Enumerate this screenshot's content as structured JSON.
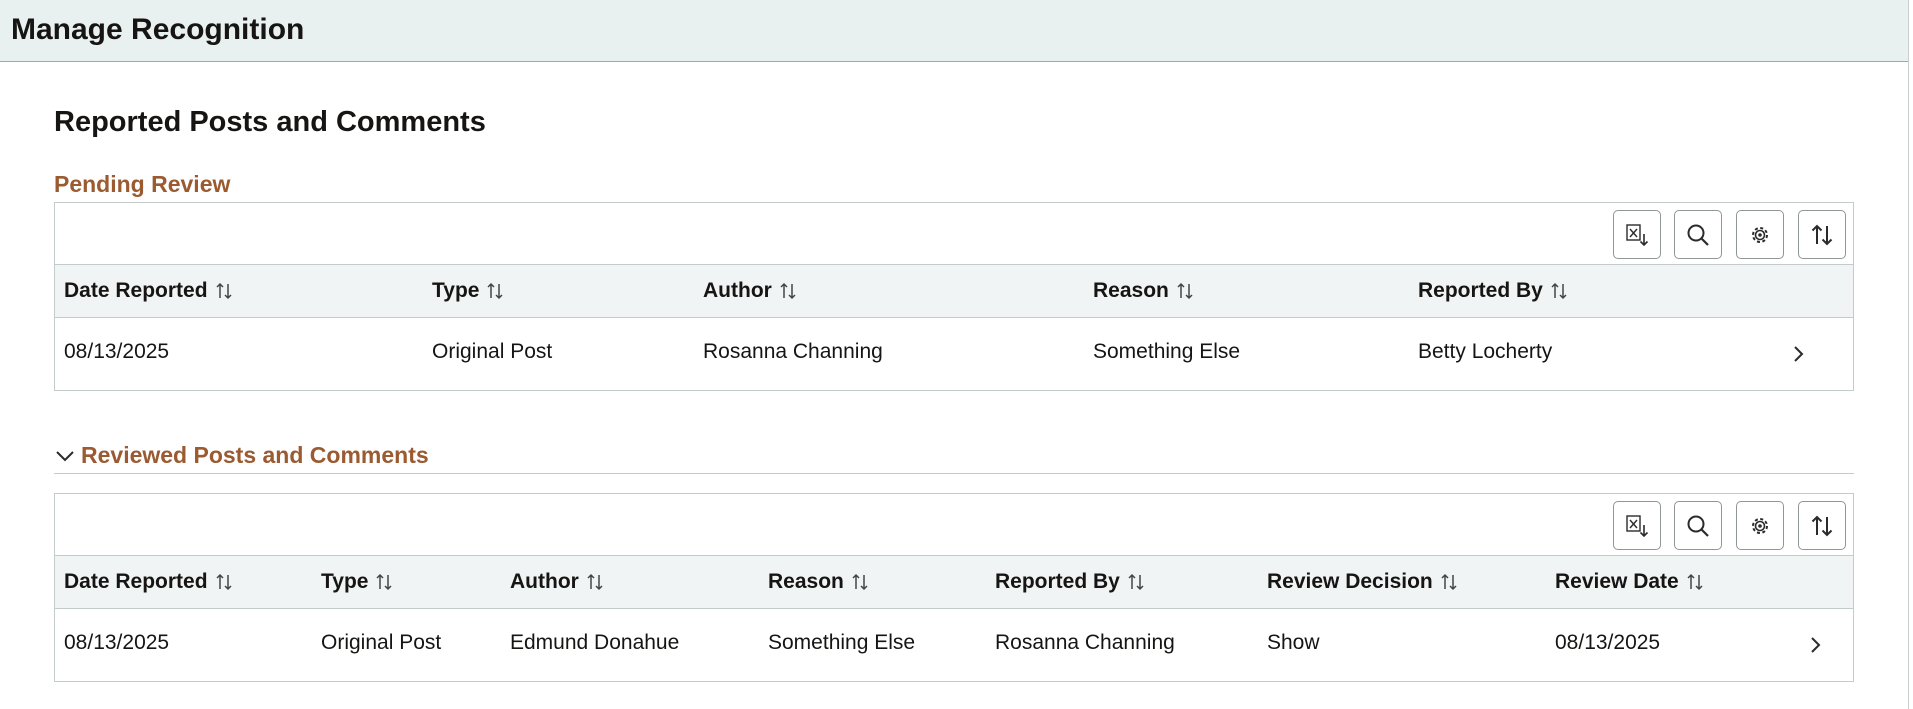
{
  "page": {
    "title": "Manage Recognition"
  },
  "section": {
    "title": "Reported Posts and Comments"
  },
  "pending": {
    "title": "Pending Review",
    "columns": [
      "Date Reported",
      "Type",
      "Author",
      "Reason",
      "Reported By"
    ],
    "rows": [
      [
        "08/13/2025",
        "Original Post",
        "Rosanna Channing",
        "Something Else",
        "Betty Locherty"
      ]
    ]
  },
  "reviewed": {
    "title": "Reviewed Posts and Comments",
    "columns": [
      "Date Reported",
      "Type",
      "Author",
      "Reason",
      "Reported By",
      "Review Decision",
      "Review Date"
    ],
    "rows": [
      [
        "08/13/2025",
        "Original Post",
        "Edmund Donahue",
        "Something Else",
        "Rosanna Channing",
        "Show",
        "08/13/2025"
      ]
    ]
  },
  "toolbar_icons": [
    "export-excel-icon",
    "search-icon",
    "settings-gear-icon",
    "sort-icon"
  ],
  "colors": {
    "accent": "#9b5a30",
    "header_bg": "#e9f0f0",
    "grid_header_bg": "#f1f4f4"
  }
}
